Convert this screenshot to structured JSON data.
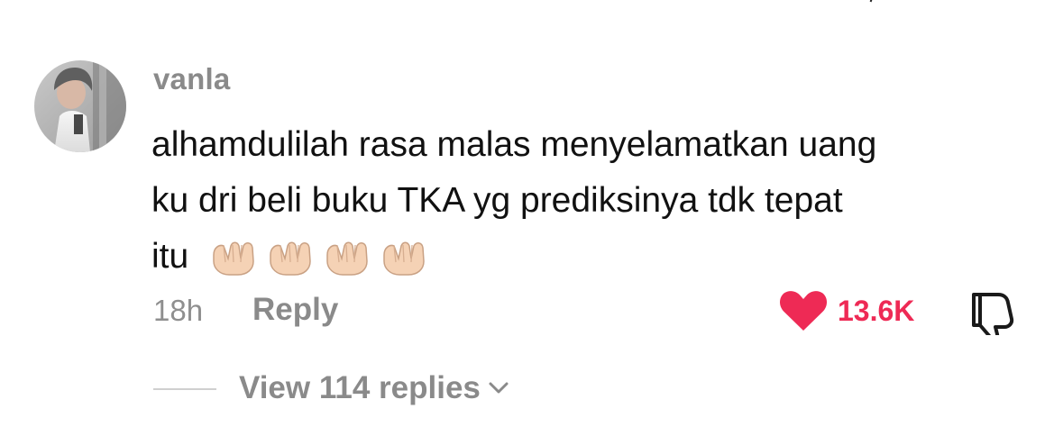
{
  "comment": {
    "username": "vanla",
    "text_lines": [
      "alhamdulilah rasa malas menyelamatkan uang",
      "ku dri beli buku TKA yg prediksinya tdk tepat",
      "itu"
    ],
    "emoji": [
      "🤲🏻",
      "🤲🏻",
      "🤲🏻",
      "🤲🏻"
    ],
    "timestamp": "18h",
    "reply_label": "Reply",
    "like_count": "13.6K",
    "liked": true,
    "view_replies_label": "View 114 replies"
  },
  "colors": {
    "accent": "#ee2a55",
    "meta_text": "#8a8a8a",
    "body_text": "#111111"
  },
  "icons": {
    "heart": "heart-icon",
    "dislike": "thumbs-down-icon",
    "chevron": "chevron-down-icon",
    "emoji": "raised-hands-icon"
  }
}
